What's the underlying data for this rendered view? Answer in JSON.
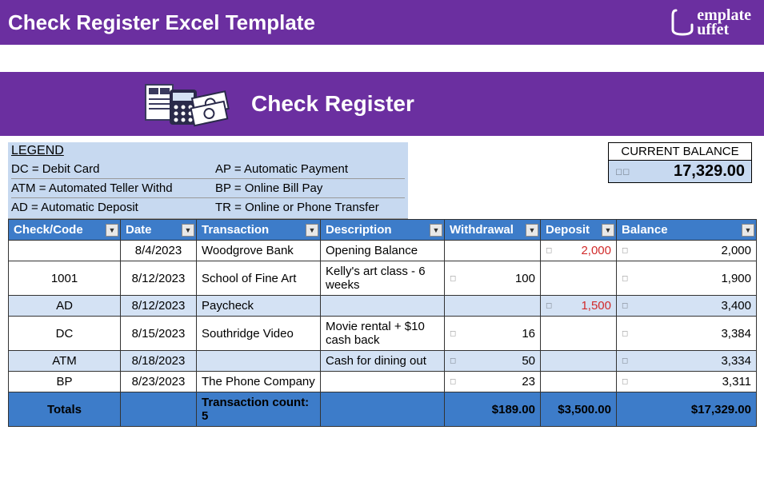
{
  "top_title": "Check Register Excel Template",
  "logo_text": "emplate\nuffet",
  "header_title": "Check Register",
  "legend": {
    "title": "LEGEND",
    "items": [
      {
        "l": "DC = Debit Card",
        "r": "AP = Automatic Payment"
      },
      {
        "l": "ATM = Automated Teller Withd",
        "r": "BP = Online Bill Pay"
      },
      {
        "l": "AD = Automatic Deposit",
        "r": "TR = Online or Phone Transfer"
      }
    ]
  },
  "balance": {
    "label": "CURRENT BALANCE",
    "value": "17,329.00"
  },
  "columns": [
    "Check/Code",
    "Date",
    "Transaction",
    "Description",
    "Withdrawal",
    "Deposit",
    "Balance"
  ],
  "rows": [
    {
      "code": "",
      "date": "8/4/2023",
      "trans": "Woodgrove Bank",
      "desc": "Opening Balance",
      "with": "",
      "dep": "2,000",
      "bal": "2,000",
      "alt": false
    },
    {
      "code": "1001",
      "date": "8/12/2023",
      "trans": "School of Fine Art",
      "desc": "Kelly's art class - 6 weeks",
      "with": "100",
      "dep": "",
      "bal": "1,900",
      "alt": false
    },
    {
      "code": "AD",
      "date": "8/12/2023",
      "trans": "Paycheck",
      "desc": "",
      "with": "",
      "dep": "1,500",
      "bal": "3,400",
      "alt": true
    },
    {
      "code": "DC",
      "date": "8/15/2023",
      "trans": "Southridge Video",
      "desc": "Movie rental + $10 cash back",
      "with": "16",
      "dep": "",
      "bal": "3,384",
      "alt": false
    },
    {
      "code": "ATM",
      "date": "8/18/2023",
      "trans": "",
      "desc": "Cash for dining out",
      "with": "50",
      "dep": "",
      "bal": "3,334",
      "alt": true
    },
    {
      "code": "BP",
      "date": "8/23/2023",
      "trans": "The Phone Company",
      "desc": "",
      "with": "23",
      "dep": "",
      "bal": "3,311",
      "alt": false
    }
  ],
  "totals": {
    "label": "Totals",
    "count_label": "Transaction count: 5",
    "withdrawal": "$189.00",
    "deposit": "$3,500.00",
    "balance": "$17,329.00"
  },
  "chart_data": {
    "type": "table",
    "title": "Check Register",
    "columns": [
      "Check/Code",
      "Date",
      "Transaction",
      "Description",
      "Withdrawal",
      "Deposit",
      "Balance"
    ],
    "rows": [
      [
        "",
        "8/4/2023",
        "Woodgrove Bank",
        "Opening Balance",
        null,
        2000,
        2000
      ],
      [
        "1001",
        "8/12/2023",
        "School of Fine Art",
        "Kelly's art class - 6 weeks",
        100,
        null,
        1900
      ],
      [
        "AD",
        "8/12/2023",
        "Paycheck",
        "",
        null,
        1500,
        3400
      ],
      [
        "DC",
        "8/15/2023",
        "Southridge Video",
        "Movie rental + $10 cash back",
        16,
        null,
        3384
      ],
      [
        "ATM",
        "8/18/2023",
        "",
        "Cash for dining out",
        50,
        null,
        3334
      ],
      [
        "BP",
        "8/23/2023",
        "The Phone Company",
        "",
        23,
        null,
        3311
      ]
    ],
    "totals": {
      "withdrawal": 189.0,
      "deposit": 3500.0,
      "balance": 17329.0,
      "transaction_count": 5
    }
  }
}
